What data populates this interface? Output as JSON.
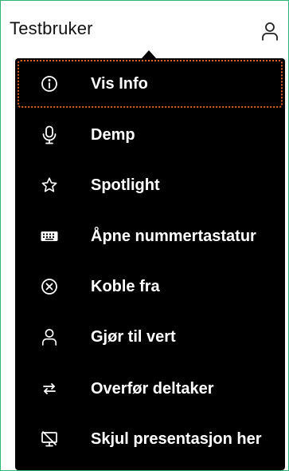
{
  "header": {
    "title": "Testbruker",
    "user_icon": "user-icon"
  },
  "menu": {
    "items": [
      {
        "label": "Vis Info",
        "icon": "info-icon",
        "focused": true
      },
      {
        "label": "Demp",
        "icon": "microphone-icon"
      },
      {
        "label": "Spotlight",
        "icon": "star-icon"
      },
      {
        "label": "Åpne nummertastatur",
        "icon": "keypad-icon"
      },
      {
        "label": "Koble fra",
        "icon": "disconnect-icon"
      },
      {
        "label": "Gjør til vert",
        "icon": "user-icon"
      },
      {
        "label": "Overfør deltaker",
        "icon": "transfer-icon"
      },
      {
        "label": "Skjul presentasjon her",
        "icon": "hide-presentation-icon"
      }
    ]
  },
  "colors": {
    "frame_border": "#2bb673",
    "menu_background": "#000000",
    "focus_outline": "#e0641e",
    "menu_text": "#ffffff"
  }
}
